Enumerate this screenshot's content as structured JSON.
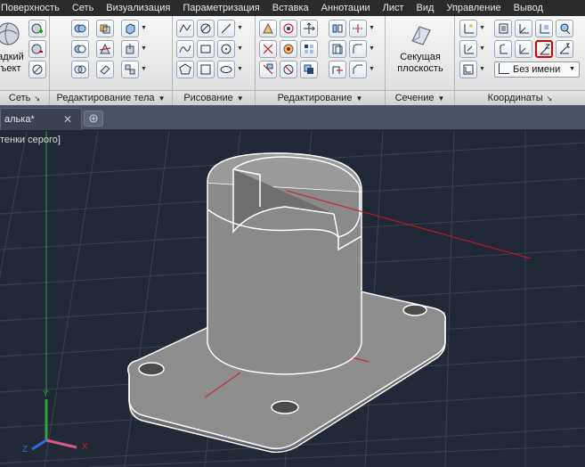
{
  "menu": {
    "tabs": [
      "Поверхность",
      "Сеть",
      "Визуализация",
      "Параметризация",
      "Вставка",
      "Аннотации",
      "Лист",
      "Вид",
      "Управление",
      "Вывод"
    ]
  },
  "ribbon": {
    "mesh_panel": {
      "title": "Сеть",
      "big_button_line1": "адкий",
      "big_button_line2": "ъект"
    },
    "solid_edit_panel": {
      "title": "Редактирование тела"
    },
    "draw_panel": {
      "title": "Рисование"
    },
    "edit_panel": {
      "title": "Редактирование"
    },
    "section_panel": {
      "title": "Сечение",
      "plane_line1": "Секущая",
      "plane_line2": "плоскость"
    },
    "coords_panel": {
      "title": "Координаты",
      "ucs_name": "Без имени"
    }
  },
  "document": {
    "tab_label": "алька*"
  },
  "viewport": {
    "label": "тенки серого]"
  },
  "colors": {
    "viewport_bg": "#212836",
    "grid": "#3a4252",
    "x_axis": "#d41a1a",
    "y_axis": "#2fa33a",
    "z_axis": "#2f6fe0",
    "model_fill": "#8a8a8a",
    "edge": "#ffffff"
  }
}
